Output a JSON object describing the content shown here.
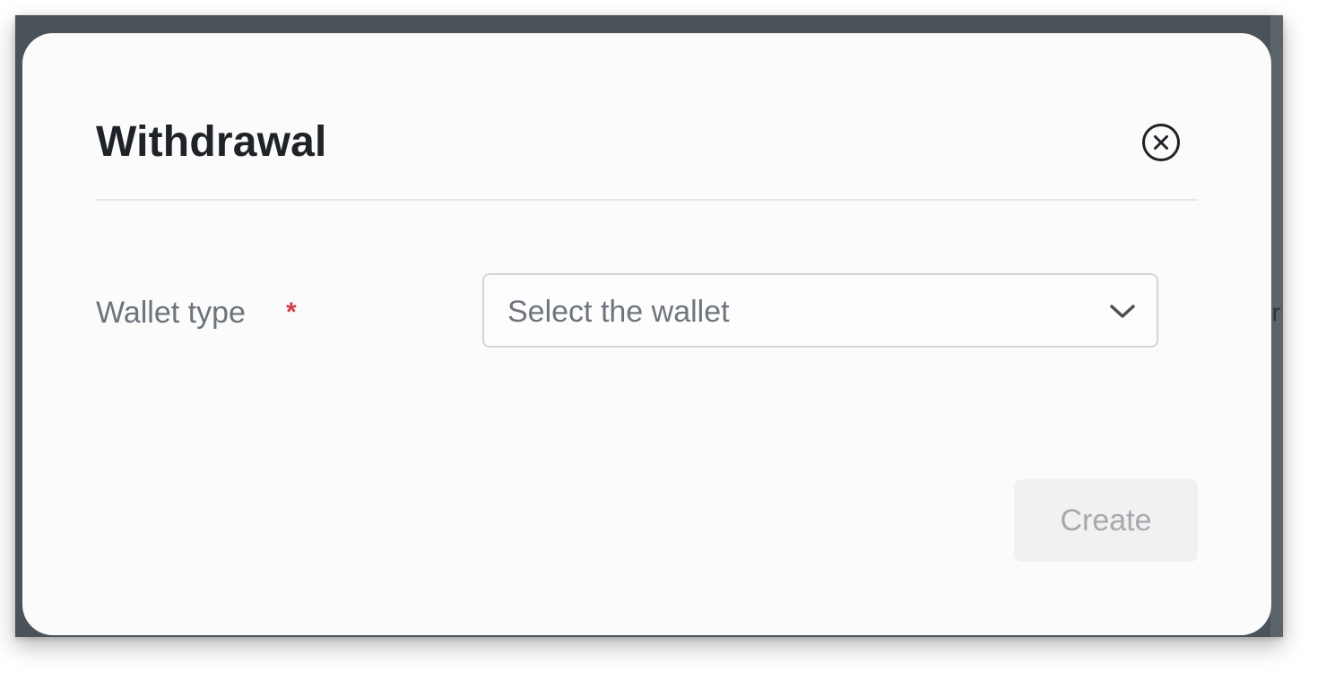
{
  "modal": {
    "title": "Withdrawal",
    "close_icon": "close-circle-icon"
  },
  "form": {
    "wallet_type": {
      "label": "Wallet type",
      "required_mark": "*",
      "placeholder": "Select the wallet",
      "dropdown_icon": "chevron-down-icon"
    }
  },
  "actions": {
    "create_label": "Create"
  },
  "colors": {
    "backdrop": "#4a5359",
    "modal_bg": "#fbfbfb",
    "required": "#d63c4a",
    "disabled_button_bg": "#f1f1f1",
    "disabled_button_text": "#a5a9ae"
  }
}
